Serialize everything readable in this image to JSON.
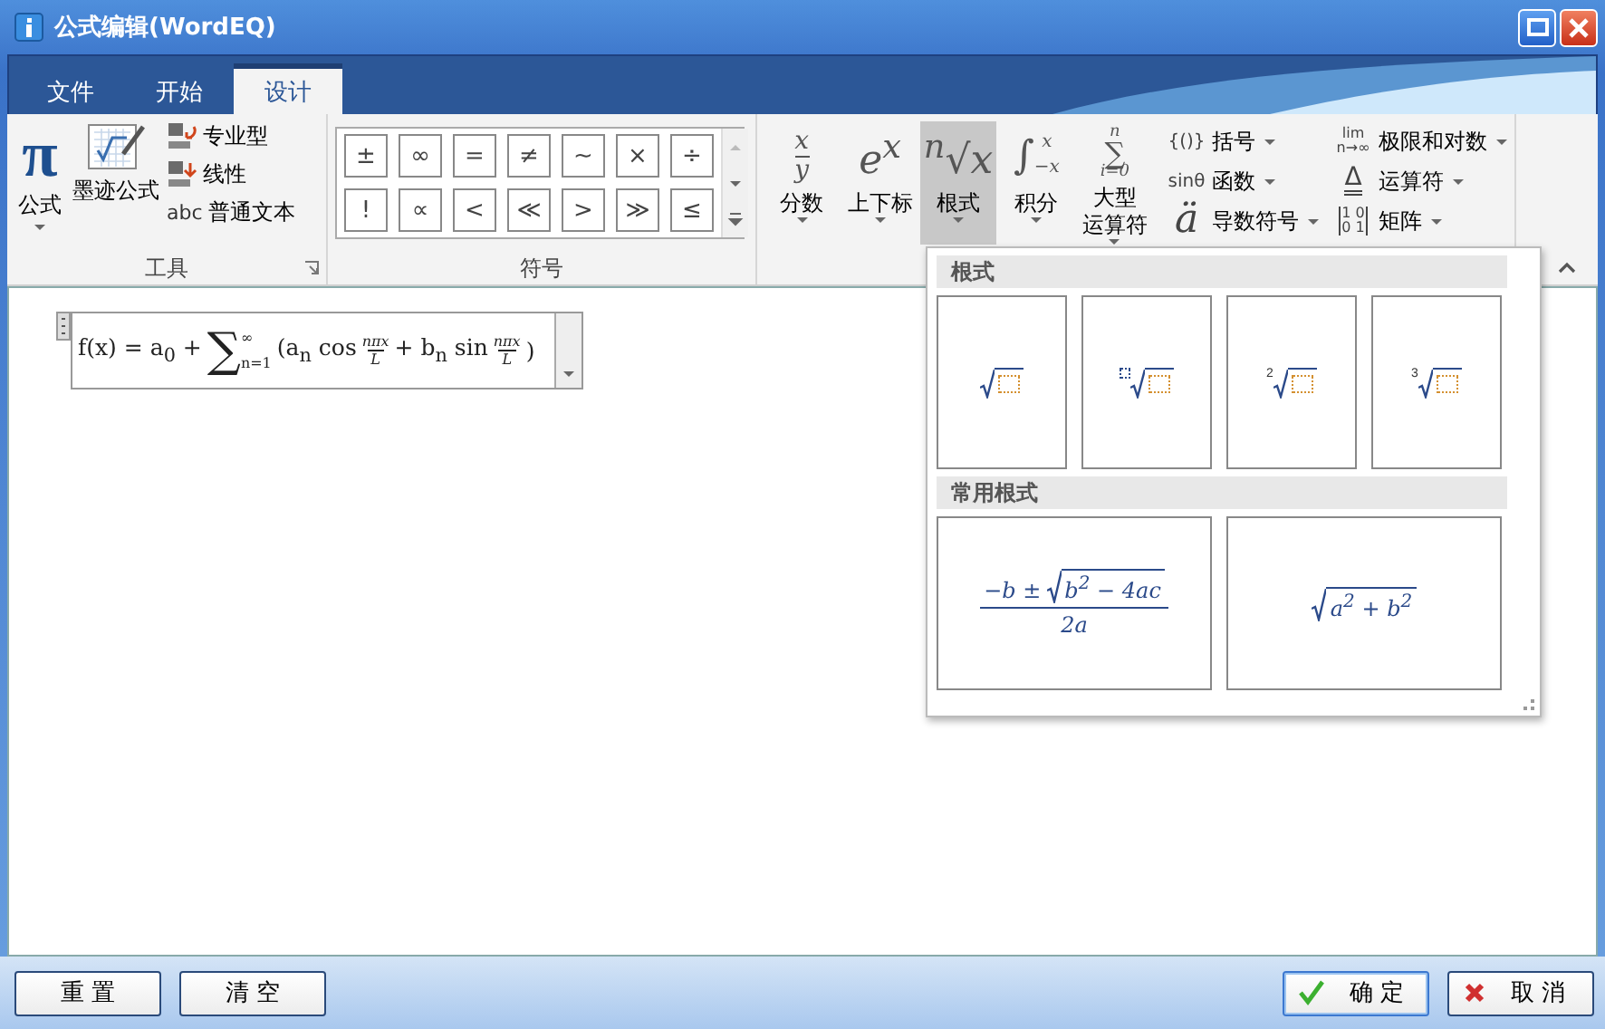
{
  "window": {
    "title": "公式编辑(WordEQ)"
  },
  "tabs": [
    {
      "label": "文件",
      "selected": false
    },
    {
      "label": "开始",
      "selected": false
    },
    {
      "label": "设计",
      "selected": true
    }
  ],
  "tools_group": {
    "label": "工具",
    "pi_glyph": "π",
    "pi_label": "公式",
    "ink_label": "墨迹公式",
    "options": [
      {
        "kind": "professional",
        "label": "专业型"
      },
      {
        "kind": "linear",
        "label": "线性"
      },
      {
        "kind": "abc",
        "glyph": "abc",
        "label": "普通文本"
      }
    ]
  },
  "symbols_group": {
    "label": "符号",
    "symbols": [
      "±",
      "∞",
      "=",
      "≠",
      "~",
      "×",
      "÷",
      "!",
      "∝",
      "<",
      "≪",
      ">",
      "≫",
      "≤"
    ]
  },
  "structures": {
    "large": [
      {
        "kind": "fraction",
        "num": "x",
        "den": "y",
        "label": "分数",
        "selected": false
      },
      {
        "kind": "glyph",
        "glyph": "e$^{x}$",
        "label": "上下标",
        "selected": false
      },
      {
        "kind": "glyph",
        "glyph": "$^{n}$√x",
        "label": "根式",
        "selected": true
      },
      {
        "kind": "integral",
        "glyph": "∫",
        "over": "x",
        "under": "−x",
        "label": "积分",
        "selected": false
      },
      {
        "kind": "operator",
        "glyph": "∑",
        "over": "n",
        "under": "i=0",
        "label": "大型",
        "label_2": "运算符",
        "selected": false
      }
    ],
    "small": [
      {
        "kind": "text",
        "glyph": "{()}",
        "label": "括号"
      },
      {
        "kind": "text",
        "glyph": "sinθ",
        "label": "函数"
      },
      {
        "kind": "big",
        "glyph": "ä",
        "label": "导数符号"
      },
      {
        "kind": "limit",
        "glyph": "lim",
        "under": "n→∞",
        "label": "极限和对数"
      },
      {
        "kind": "delta",
        "glyph": "Δ",
        "label": "运算符"
      },
      {
        "kind": "matrix",
        "rows": [
          "1 0",
          "0 1"
        ],
        "label": "矩阵"
      }
    ]
  },
  "equation": [
    {
      "kind": "text",
      "text": "f(x) = a$_{0}$ + "
    },
    {
      "kind": "sum",
      "glyph": "∑",
      "over": "∞",
      "under": "n=1"
    },
    {
      "kind": "text",
      "text": "(a$_{n}$ cos"
    },
    {
      "kind": "frac",
      "num": "nπx",
      "den": "L"
    },
    {
      "kind": "text",
      "text": "+ b$_{n}$ sin"
    },
    {
      "kind": "frac",
      "num": "nπx",
      "den": "L"
    },
    {
      "kind": "text",
      "text": ")"
    }
  ],
  "gallery": {
    "sections": [
      {
        "title": "根式",
        "items": [
          {
            "kind": "sqrt"
          },
          {
            "kind": "root-placeholder"
          },
          {
            "kind": "root",
            "index": "2"
          },
          {
            "kind": "root",
            "index": "3"
          }
        ]
      },
      {
        "title": "常用根式",
        "items": [
          {
            "kind": "quadratic",
            "before": "−b ±",
            "radicand": "b$^{2}$ − 4ac",
            "den": "2a"
          },
          {
            "kind": "sqrt-expr",
            "radicand": "a$^{2}$ + b$^{2}$"
          }
        ]
      }
    ]
  },
  "footer": {
    "left": [
      {
        "kind": "plain",
        "label": "重 置"
      },
      {
        "kind": "plain",
        "label": "清 空"
      }
    ],
    "right": [
      {
        "kind": "ok",
        "label": "确 定"
      },
      {
        "kind": "cancel",
        "label": "取 消"
      }
    ]
  }
}
